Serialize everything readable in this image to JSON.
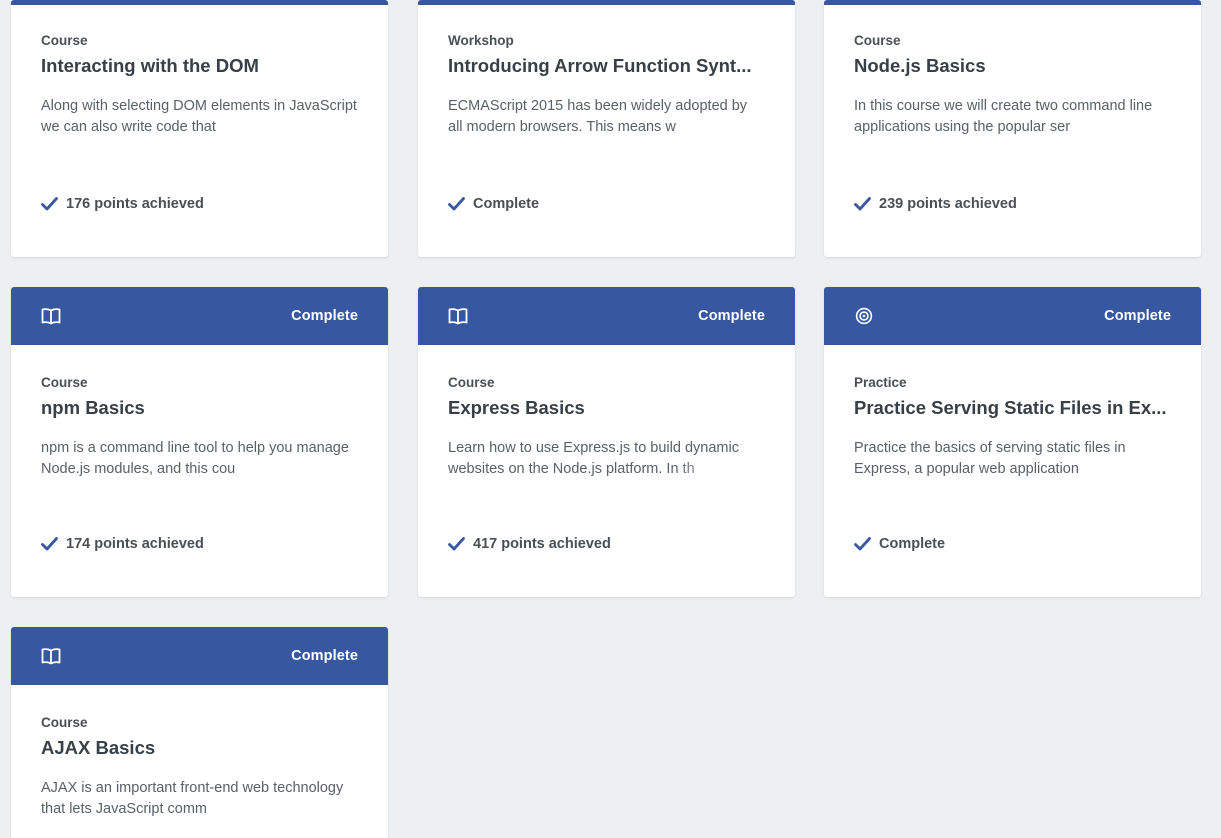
{
  "accent_color": "#3757a0",
  "cards": [
    {
      "type": "Course",
      "title": "Interacting with the DOM",
      "description": "Along with selecting DOM elements in JavaScript we can also write code that",
      "status": "176 points achieved"
    },
    {
      "type": "Workshop",
      "title": "Introducing Arrow Function Synt...",
      "description": "ECMAScript 2015 has been widely adopted by all modern browsers. This means w",
      "status": "Complete"
    },
    {
      "type": "Course",
      "title": "Node.js Basics",
      "description": "In this course we will create two command line applications using the popular ser",
      "status": "239 points achieved"
    },
    {
      "header_icon": "book-icon",
      "header_status": "Complete",
      "type": "Course",
      "title": "npm Basics",
      "description": "npm is a command line tool to help you manage Node.js modules, and this cou",
      "status": "174 points achieved"
    },
    {
      "header_icon": "book-icon",
      "header_status": "Complete",
      "type": "Course",
      "title": "Express Basics",
      "description": "Learn how to use Express.js to build dynamic websites on the Node.js platform. In th",
      "status": "417 points achieved"
    },
    {
      "header_icon": "target-icon",
      "header_status": "Complete",
      "type": "Practice",
      "title": "Practice Serving Static Files in Ex...",
      "description": "Practice the basics of serving static files in Express, a popular web application",
      "status": "Complete"
    },
    {
      "header_icon": "book-icon",
      "header_status": "Complete",
      "type": "Course",
      "title": "AJAX Basics",
      "description": "AJAX is an important front-end web technology that lets JavaScript comm",
      "status": ""
    }
  ]
}
